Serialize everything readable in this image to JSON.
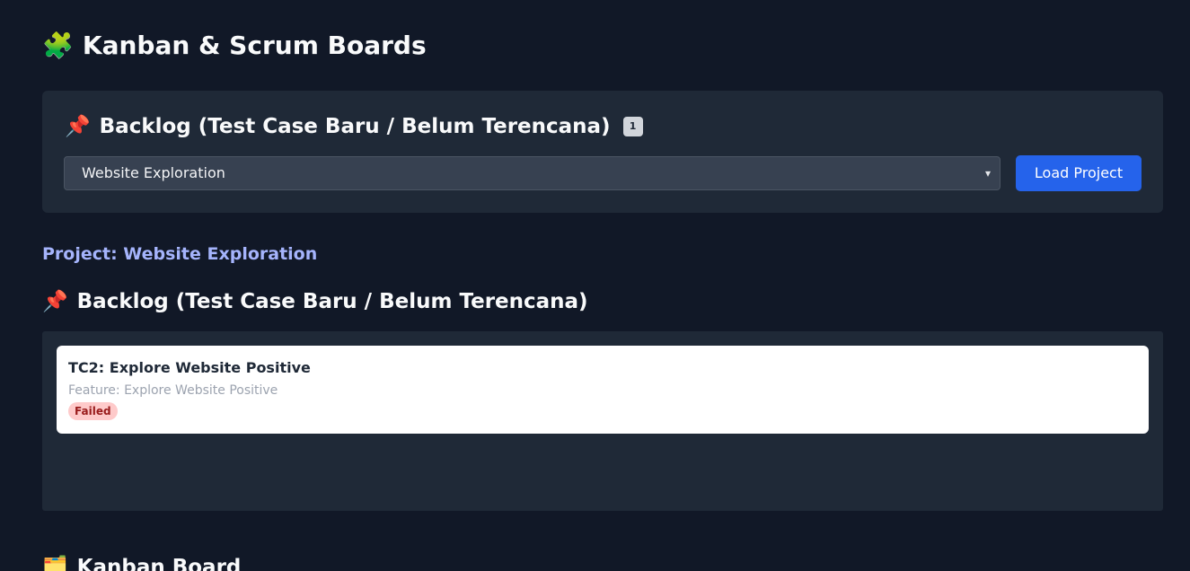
{
  "page": {
    "title": "Kanban & Scrum Boards",
    "title_icon": "🧩"
  },
  "top_panel": {
    "heading": "Backlog (Test Case Baru / Belum Terencana)",
    "heading_icon": "📌",
    "count": "1",
    "project_select": {
      "selected": "Website Exploration",
      "chevron": "▾"
    },
    "load_button_label": "Load Project"
  },
  "project": {
    "label": "Project: Website Exploration"
  },
  "backlog": {
    "heading": "Backlog (Test Case Baru / Belum Terencana)",
    "heading_icon": "📌",
    "cards": [
      {
        "title": "TC2: Explore Website Positive",
        "feature": "Feature: Explore Website Positive",
        "status": "Failed"
      }
    ]
  },
  "kanban": {
    "heading": "Kanban Board",
    "heading_icon": "🗂️"
  },
  "colors": {
    "background": "#111827",
    "panel": "#1f2937",
    "accent": "#2563eb",
    "project_label": "#a5b4fc",
    "failed_bg": "#fecaca",
    "failed_text": "#991b1b"
  }
}
